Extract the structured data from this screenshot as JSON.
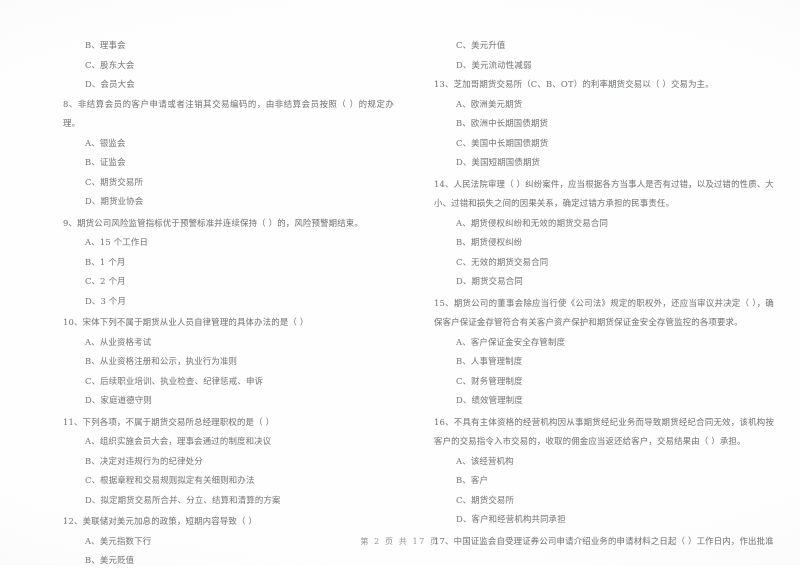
{
  "document": {
    "type": "scanned-exam-paper",
    "footer": "第 2 页  共 17 页"
  },
  "left_column": {
    "orphan_options": [
      "B、理事会",
      "C、股东大会",
      "D、会员大会"
    ],
    "questions": [
      {
        "number": "8",
        "stem": "8、非结算会员的客户申请或者注销其交易编码的，由非结算会员按照（      ）的规定办理。",
        "options": [
          "A、银监会",
          "B、证监会",
          "C、期货交易所",
          "D、期货业协会"
        ]
      },
      {
        "number": "9",
        "stem": "9、期货公司风险监管指标优于预警标准并连续保持（      ）的，风险预警期结束。",
        "options": [
          "A、15 个工作日",
          "B、1 个月",
          "C、2 个月",
          "D、3 个月"
        ]
      },
      {
        "number": "10",
        "stem": "10、宋体下列不属于期货从业人员自律管理的具体办法的是（      ）",
        "options": [
          "A、从业资格考试",
          "B、从业资格注册和公示，执业行为准则",
          "C、后续职业培训、执业检查、纪律惩戒、申诉",
          "D、家庭道德守则"
        ]
      },
      {
        "number": "11",
        "stem": "11、下列各项，不属于期货交易所总经理职权的是（      ）",
        "options": [
          "A、组织实施会员大会，理事会通过的制度和决议",
          "B、决定对违规行为的纪律处分",
          "C、根据章程和交易规则拟定有关细则和办法",
          "D、拟定期货交易所合并、分立、结算和清算的方案"
        ]
      },
      {
        "number": "12",
        "stem": "12、美联储对美元加息的政策，短期内容导致（      ）",
        "options": [
          "A、美元指数下行",
          "B、美元贬值"
        ]
      }
    ]
  },
  "right_column": {
    "orphan_options": [
      "C、美元升值",
      "D、美元流动性减弱"
    ],
    "questions": [
      {
        "number": "13",
        "stem": "13、芝加哥期货交易所（C、B、OT）的利率期货交易以（      ）交易为主。",
        "options": [
          "A、欧洲美元期货",
          "B、欧洲中长期国债期货",
          "C、美国中长期国债期货",
          "D、美国短期国债期货"
        ]
      },
      {
        "number": "14",
        "stem": "14、人民法院审理（      ）纠纷案件，应当根据各方当事人是否有过错，以及过错的性质、大小、过错和损失之间的因果关系，确定过错方承担的民事责任。",
        "options": [
          "A、期货侵权纠纷和无效的期货交易合同",
          "B、期货侵权纠纷",
          "C、无效的期货交易合同",
          "D、期货交易合同"
        ]
      },
      {
        "number": "15",
        "stem": "15、期货公司的董事会除应当行使《公司法》规定的职权外，还应当审议并决定（      ），确保客户保证金存管符合有关客户资产保护和期货保证金安全存管监控的各项要求。",
        "options": [
          "A、客户保证金安全存管制度",
          "B、人事管理制度",
          "C、财务管理制度",
          "D、绩效管理制度"
        ]
      },
      {
        "number": "16",
        "stem": "16、不具有主体资格的经营机构因从事期货经纪业务而导致期货经纪合同无效，该机构按客户的交易指令入市交易的，收取的佣金应当返还给客户，交易结果由（      ）承担。",
        "options": [
          "A、该经营机构",
          "B、客户",
          "C、期货交易所",
          "D、客户和经营机构共同承担"
        ]
      },
      {
        "number": "17",
        "stem": "17、中国证监会自受理证券公司申请介绍业务的申请材料之日起（      ）工作日内，作出批准",
        "options": []
      }
    ]
  }
}
